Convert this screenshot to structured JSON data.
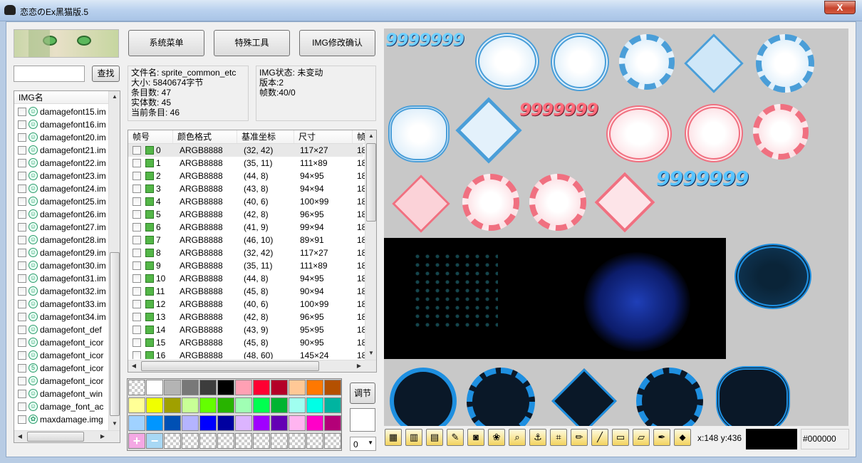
{
  "window": {
    "title": "恋恋のEx黑猫版.5",
    "close_symbol": "X"
  },
  "toolbar": {
    "menu_label": "系统菜单",
    "special_label": "特殊工具",
    "confirm_label": "IMG修改确认"
  },
  "search": {
    "value": "",
    "button_label": "查找"
  },
  "file_info": {
    "name": "文件名: sprite_common_etc",
    "size": "大小: 5840674字节",
    "entries": "条目数: 47",
    "real": "实体数: 45",
    "current": "当前条目: 46"
  },
  "img_status": {
    "status": "IMG状态: 未变动",
    "version": "版本:2",
    "frames": "帧数:40/0"
  },
  "img_list": {
    "header": "IMG名",
    "items": [
      {
        "name": "damagefont15.im",
        "icon": "face-icon"
      },
      {
        "name": "damagefont16.im",
        "icon": "face-icon"
      },
      {
        "name": "damagefont20.im",
        "icon": "face-icon"
      },
      {
        "name": "damagefont21.im",
        "icon": "face-icon"
      },
      {
        "name": "damagefont22.im",
        "icon": "face-icon"
      },
      {
        "name": "damagefont23.im",
        "icon": "face-icon"
      },
      {
        "name": "damagefont24.im",
        "icon": "face-icon"
      },
      {
        "name": "damagefont25.im",
        "icon": "face-icon"
      },
      {
        "name": "damagefont26.im",
        "icon": "face-icon"
      },
      {
        "name": "damagefont27.im",
        "icon": "face-icon"
      },
      {
        "name": "damagefont28.im",
        "icon": "face-icon"
      },
      {
        "name": "damagefont29.im",
        "icon": "face-icon"
      },
      {
        "name": "damagefont30.im",
        "icon": "face-icon"
      },
      {
        "name": "damagefont31.im",
        "icon": "face-icon"
      },
      {
        "name": "damagefont32.im",
        "icon": "face-icon"
      },
      {
        "name": "damagefont33.im",
        "icon": "face-icon"
      },
      {
        "name": "damagefont34.im",
        "icon": "face-icon"
      },
      {
        "name": "damagefont_def",
        "icon": "face-icon"
      },
      {
        "name": "damagefont_icor",
        "icon": "face-icon"
      },
      {
        "name": "damagefont_icor",
        "icon": "face-icon"
      },
      {
        "name": "damagefont_icor",
        "icon": "five-icon"
      },
      {
        "name": "damagefont_icor",
        "icon": "face-icon"
      },
      {
        "name": "damagefont_win",
        "icon": "face-icon"
      },
      {
        "name": "damage_font_ac",
        "icon": "face-icon"
      },
      {
        "name": "maxdamage.img",
        "icon": "gear-icon"
      }
    ]
  },
  "frame_table": {
    "headers": [
      "帧号",
      "颜色格式",
      "基准坐标",
      "尺寸",
      "帧"
    ],
    "rows": [
      {
        "id": "0",
        "fmt": "ARGB8888",
        "pos": "(32, 42)",
        "size": "117×27",
        "extra": "18"
      },
      {
        "id": "1",
        "fmt": "ARGB8888",
        "pos": "(35, 11)",
        "size": "111×89",
        "extra": "18"
      },
      {
        "id": "2",
        "fmt": "ARGB8888",
        "pos": "(44, 8)",
        "size": "94×95",
        "extra": "18"
      },
      {
        "id": "3",
        "fmt": "ARGB8888",
        "pos": "(43, 8)",
        "size": "94×94",
        "extra": "18"
      },
      {
        "id": "4",
        "fmt": "ARGB8888",
        "pos": "(40, 6)",
        "size": "100×99",
        "extra": "18"
      },
      {
        "id": "5",
        "fmt": "ARGB8888",
        "pos": "(42, 8)",
        "size": "96×95",
        "extra": "18"
      },
      {
        "id": "6",
        "fmt": "ARGB8888",
        "pos": "(41, 9)",
        "size": "99×94",
        "extra": "18"
      },
      {
        "id": "7",
        "fmt": "ARGB8888",
        "pos": "(46, 10)",
        "size": "89×91",
        "extra": "18"
      },
      {
        "id": "8",
        "fmt": "ARGB8888",
        "pos": "(32, 42)",
        "size": "117×27",
        "extra": "18"
      },
      {
        "id": "9",
        "fmt": "ARGB8888",
        "pos": "(35, 11)",
        "size": "111×89",
        "extra": "18"
      },
      {
        "id": "10",
        "fmt": "ARGB8888",
        "pos": "(44, 8)",
        "size": "94×95",
        "extra": "18"
      },
      {
        "id": "11",
        "fmt": "ARGB8888",
        "pos": "(45, 8)",
        "size": "90×94",
        "extra": "18"
      },
      {
        "id": "12",
        "fmt": "ARGB8888",
        "pos": "(40, 6)",
        "size": "100×99",
        "extra": "18"
      },
      {
        "id": "13",
        "fmt": "ARGB8888",
        "pos": "(42, 8)",
        "size": "96×95",
        "extra": "18"
      },
      {
        "id": "14",
        "fmt": "ARGB8888",
        "pos": "(43, 9)",
        "size": "95×95",
        "extra": "18"
      },
      {
        "id": "15",
        "fmt": "ARGB8888",
        "pos": "(45, 8)",
        "size": "90×95",
        "extra": "18"
      },
      {
        "id": "16",
        "fmt": "ARGB8888",
        "pos": "(48, 60)",
        "size": "145×24",
        "extra": "18"
      }
    ]
  },
  "palette": {
    "colors": [
      "checker",
      "#ffffff",
      "#b4b4b4",
      "#787878",
      "#3c3c3c",
      "#000000",
      "#ffa0b4",
      "#ff0032",
      "#b40028",
      "#ffc896",
      "#ff7800",
      "#b45000",
      "#ffff96",
      "#f0ff00",
      "#a0a000",
      "#c8ff96",
      "#64ff00",
      "#28b400",
      "#a0ffb4",
      "#00ff50",
      "#00b432",
      "#a0fff0",
      "#00ffe6",
      "#00b4a0",
      "#a0d2ff",
      "#0096ff",
      "#0050b4",
      "#b4b4ff",
      "#0000ff",
      "#0000a0",
      "#dcb4ff",
      "#a000ff",
      "#6400b4",
      "#ffb4f0",
      "#ff00c8",
      "#b40078",
      "plus",
      "minus",
      "checker",
      "checker",
      "checker",
      "checker",
      "checker",
      "checker",
      "checker",
      "checker",
      "checker",
      "checker"
    ],
    "adjust_label": "调节",
    "select_value": "0"
  },
  "canvas": {
    "damage_text": "9999999",
    "coord_readout": "x:148 y:436",
    "color_hex": "#000000"
  },
  "tools": [
    "palette-tool-icon",
    "color-tool-icon",
    "film-icon",
    "paint-icon",
    "camera-icon",
    "shape-icon",
    "zoom-icon",
    "anchor-icon",
    "crop-icon",
    "pen-icon",
    "line-icon",
    "rect-icon",
    "eraser-icon",
    "eyedropper-icon",
    "fill-icon"
  ]
}
